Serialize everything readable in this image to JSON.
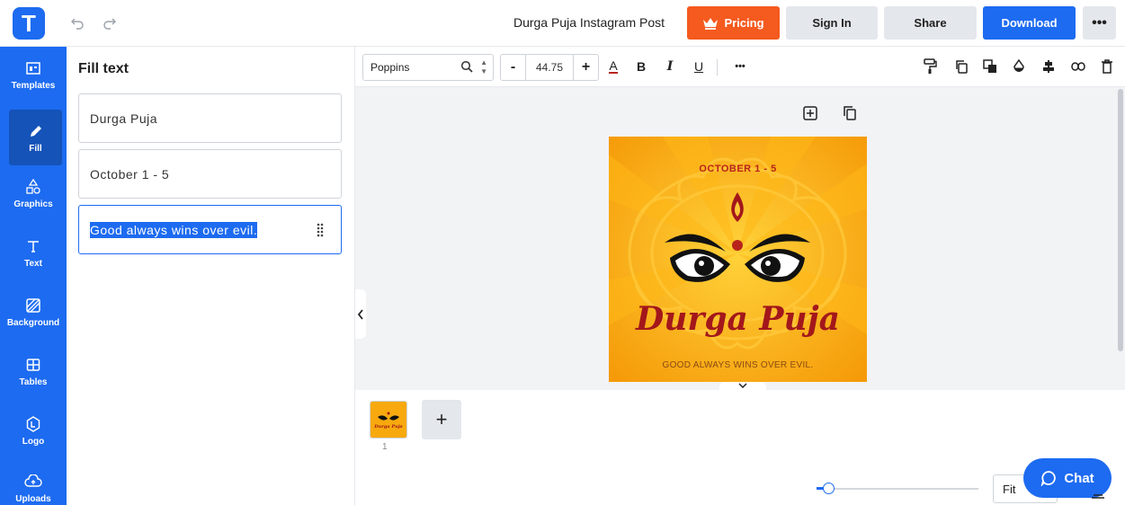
{
  "app": {
    "logo_letter": "T",
    "document_title": "Durga Puja Instagram Post"
  },
  "header": {
    "pricing_label": "Pricing",
    "signin_label": "Sign In",
    "share_label": "Share",
    "download_label": "Download",
    "more_label": "•••"
  },
  "sidebar": {
    "items": [
      {
        "label": "Templates",
        "icon": "templates-icon"
      },
      {
        "label": "Fill",
        "icon": "pencil-icon",
        "active": true
      },
      {
        "label": "Graphics",
        "icon": "shapes-icon"
      },
      {
        "label": "Text",
        "icon": "text-icon"
      },
      {
        "label": "Background",
        "icon": "background-icon"
      },
      {
        "label": "Tables",
        "icon": "table-icon"
      },
      {
        "label": "Logo",
        "icon": "logo-icon"
      },
      {
        "label": "Uploads",
        "icon": "upload-cloud-icon"
      }
    ]
  },
  "panel": {
    "title": "Fill text",
    "fields": [
      {
        "value": "Durga Puja"
      },
      {
        "value": "October 1 - 5"
      },
      {
        "value": "Good always wins over evil.",
        "selected": true
      }
    ]
  },
  "toolbar": {
    "font_name": "Poppins",
    "font_size": "44.75",
    "minus": "-",
    "plus": "+",
    "color_letter": "A",
    "bold_letter": "B",
    "italic_letter": "I",
    "underline_letter": "U",
    "more": "•••",
    "text_color": "#b8231b"
  },
  "design": {
    "date_text": "OCTOBER 1 - 5",
    "title_text": "Durga Puja",
    "tagline_text": "GOOD ALWAYS WINS OVER EVIL.",
    "thumb_title": "Durga Puja"
  },
  "pages": {
    "page_number": "1",
    "add_label": "+"
  },
  "zoom": {
    "fit_label": "Fit",
    "level_fraction": 0.05
  },
  "chat": {
    "label": "Chat"
  },
  "colors": {
    "brand": "#1d6bf0",
    "pricing": "#f55a1e",
    "design_bg": "#f7a90e",
    "design_red": "#a3171b"
  }
}
